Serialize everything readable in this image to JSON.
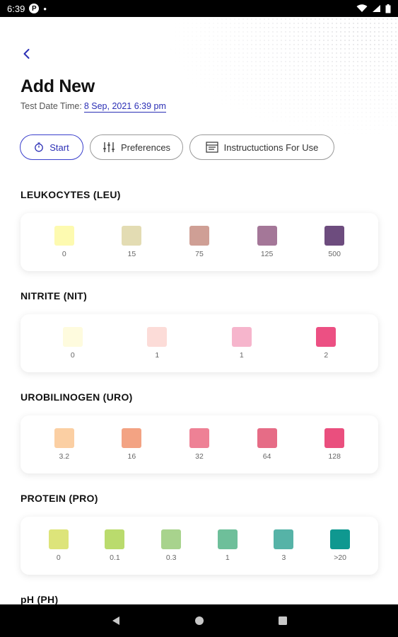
{
  "status": {
    "time": "6:39",
    "notif_badge": "P"
  },
  "header": {
    "title": "Add New",
    "datetime_label": "Test Date Time:",
    "datetime_value": "8 Sep, 2021 6:39 pm"
  },
  "actions": {
    "start": "Start",
    "preferences": "Preferences",
    "instructions": "Instructuctions For Use"
  },
  "sections": [
    {
      "title": "LEUKOCYTES (LEU)",
      "swatches": [
        {
          "label": "0",
          "color": "#fdfab0"
        },
        {
          "label": "15",
          "color": "#e3dcb3"
        },
        {
          "label": "75",
          "color": "#cf9f95"
        },
        {
          "label": "125",
          "color": "#a47798"
        },
        {
          "label": "500",
          "color": "#6d4c7e"
        }
      ]
    },
    {
      "title": "NITRITE (NIT)",
      "swatches": [
        {
          "label": "0",
          "color": "#fefbde"
        },
        {
          "label": "1",
          "color": "#fcdcd8"
        },
        {
          "label": "1",
          "color": "#f6b5cc"
        },
        {
          "label": "2",
          "color": "#ec5083"
        }
      ]
    },
    {
      "title": "UROBILINOGEN (URO)",
      "swatches": [
        {
          "label": "3.2",
          "color": "#fbcfa3"
        },
        {
          "label": "16",
          "color": "#f3a383"
        },
        {
          "label": "32",
          "color": "#ee8195"
        },
        {
          "label": "64",
          "color": "#e66c86"
        },
        {
          "label": "128",
          "color": "#ea4f7e"
        }
      ]
    },
    {
      "title": "PROTEIN (PRO)",
      "swatches": [
        {
          "label": "0",
          "color": "#dde47a"
        },
        {
          "label": "0.1",
          "color": "#badb6d"
        },
        {
          "label": "0.3",
          "color": "#a8d38d"
        },
        {
          "label": "1",
          "color": "#6ebf9a"
        },
        {
          "label": "3",
          "color": "#56b3a7"
        },
        {
          "label": ">20",
          "color": "#0f9890"
        }
      ]
    },
    {
      "title": "pH (PH)",
      "swatches": []
    }
  ],
  "colors": {
    "accent": "#2b2fb5"
  }
}
